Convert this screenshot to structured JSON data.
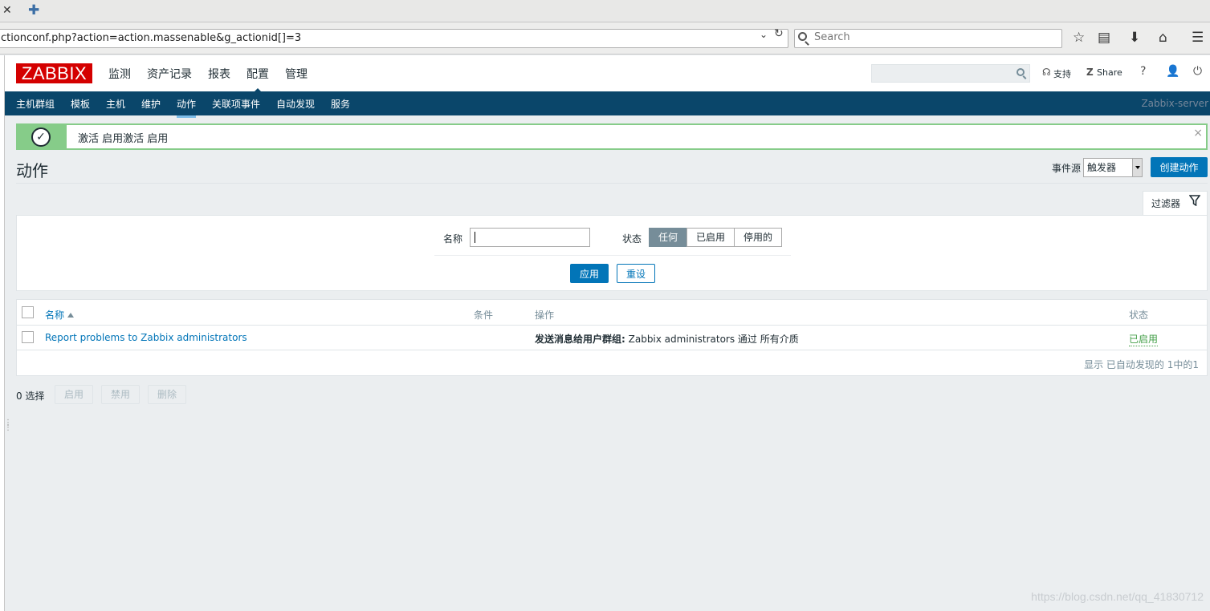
{
  "browser": {
    "url": "ctionconf.php?action=action.massenable&g_actionid[]=3",
    "search_placeholder": "Search",
    "close_glyph": "✕",
    "newtab_glyph": "✚"
  },
  "header": {
    "logo": "ZABBIX",
    "menu": [
      "监测",
      "资产记录",
      "报表",
      "配置",
      "管理"
    ],
    "active_menu": "配置",
    "support": "支持",
    "share": "Share",
    "help": "?"
  },
  "submenu": {
    "items": [
      "主机群组",
      "模板",
      "主机",
      "维护",
      "动作",
      "关联项事件",
      "自动发现",
      "服务"
    ],
    "active": "动作",
    "server": "Zabbix-server"
  },
  "message": {
    "text": "激活 启用激活 启用",
    "status": "success",
    "close": "×"
  },
  "page": {
    "title": "动作",
    "event_source_label": "事件源",
    "event_source_value": "触发器",
    "create_button": "创建动作"
  },
  "filter": {
    "tab_label": "过滤器",
    "name_label": "名称",
    "name_value": "",
    "status_label": "状态",
    "status_options": [
      "任何",
      "已启用",
      "停用的"
    ],
    "status_selected": "任何",
    "apply": "应用",
    "reset": "重设"
  },
  "table": {
    "headers": {
      "name": "名称",
      "conditions": "条件",
      "operations": "操作",
      "status": "状态"
    },
    "rows": [
      {
        "name": "Report problems to Zabbix administrators",
        "conditions": "",
        "operation_bold": "发送消息给用户群组:",
        "operation_rest": " Zabbix administrators 通过 所有介质",
        "status": "已启用"
      }
    ],
    "footer": "显示 已自动发现的 1中的1"
  },
  "mass_actions": {
    "selected": "0 选择",
    "enable": "启用",
    "disable": "禁用",
    "delete": "删除"
  },
  "watermark": "https://blog.csdn.net/qq_41830712",
  "colors": {
    "brand": "#d40000",
    "nav": "#0a466a",
    "primary": "#0275b8",
    "success": "#86cc89",
    "enabled": "#429e47"
  }
}
